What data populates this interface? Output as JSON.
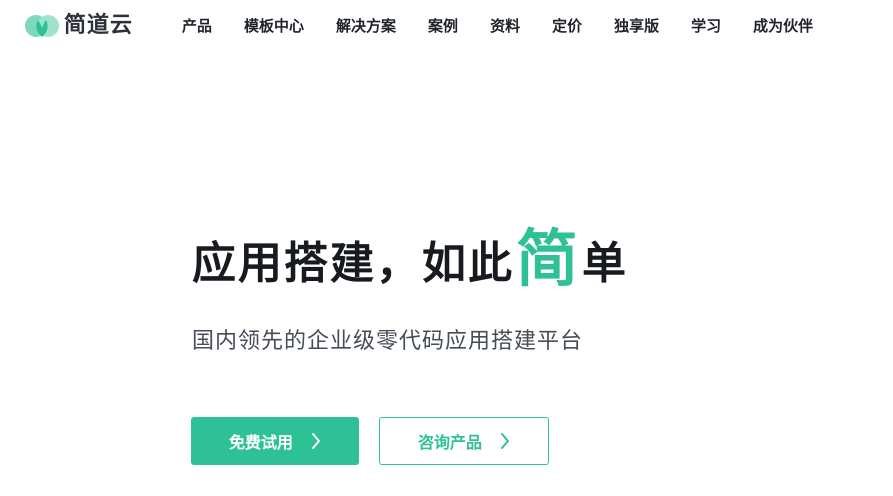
{
  "header": {
    "logo_text": "简道云",
    "nav": [
      {
        "label": "产品"
      },
      {
        "label": "模板中心"
      },
      {
        "label": "解决方案"
      },
      {
        "label": "案例"
      },
      {
        "label": "资料"
      },
      {
        "label": "定价"
      },
      {
        "label": "独享版"
      },
      {
        "label": "学习"
      },
      {
        "label": "成为伙伴"
      }
    ]
  },
  "hero": {
    "headline_prefix": "应用搭建，如此",
    "headline_accent": "简",
    "headline_suffix": "单",
    "subtitle": "国内领先的企业级零代码应用搭建平台",
    "primary_button": "免费试用",
    "secondary_button": "咨询产品"
  },
  "colors": {
    "brand": "#2fc196",
    "brand_light": "#7dd8bd",
    "text": "#1f2329",
    "subtext": "#474d55"
  },
  "icons": {
    "logo": "jiandaoyun-logo-icon",
    "button_arrow": "chevron-right-icon"
  }
}
